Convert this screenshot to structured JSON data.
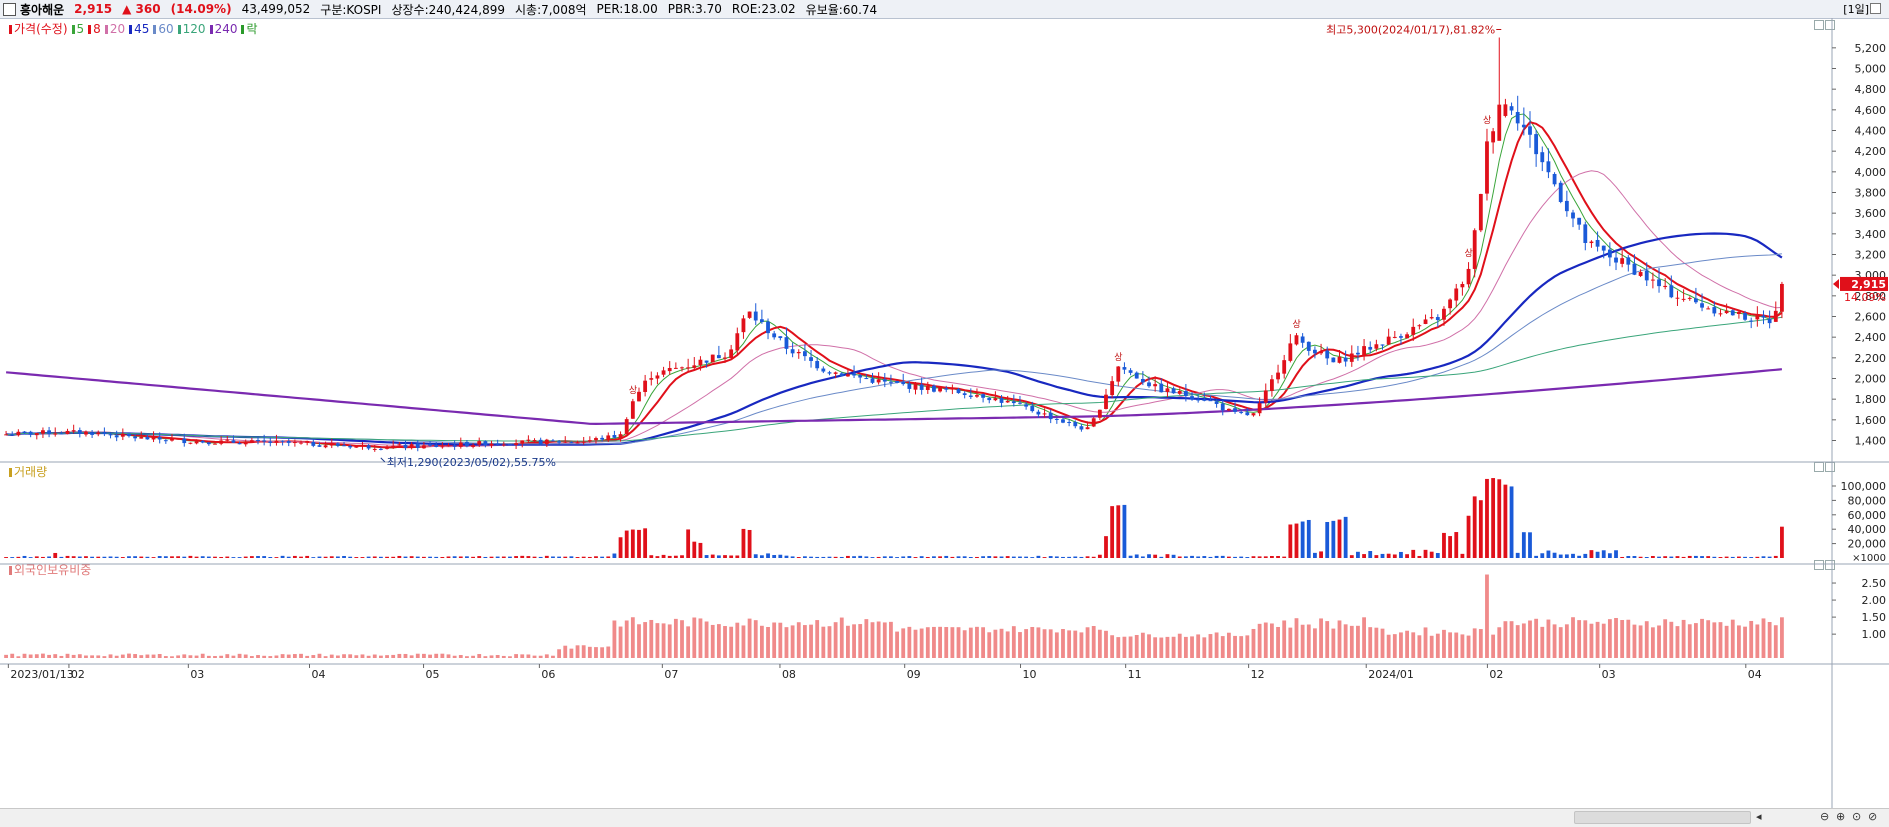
{
  "header": {
    "name": "흥아해운",
    "price": "2,915",
    "change": "▲ 360",
    "change_pct": "(14.09%)",
    "volume": "43,499,052",
    "market": "구분:KOSPI",
    "shares": "상장수:240,424,899",
    "cap": "시총:7,008억",
    "per": "PER:18.00",
    "pbr": "PBR:3.70",
    "roe": "ROE:23.02",
    "float": "유보율:60.74",
    "period": "[1일]"
  },
  "price_panel": {
    "legend": [
      {
        "label": "가격(수정)",
        "color": "#e0101a"
      },
      {
        "label": "5",
        "color": "#3aa53a"
      },
      {
        "label": "8",
        "color": "#e0101a"
      },
      {
        "label": "20",
        "color": "#d070a8"
      },
      {
        "label": "45",
        "color": "#1828c0"
      },
      {
        "label": "60",
        "color": "#6a8ac8"
      },
      {
        "label": "120",
        "color": "#3aa57a"
      },
      {
        "label": "240",
        "color": "#7a2ab0"
      },
      {
        "label": "락",
        "color": "#2a9a2a"
      }
    ],
    "high_annotation": "최고5,300(2024/01/17),81.82%",
    "low_annotation": "최저1,290(2023/05/02),55.75%",
    "price_tag": "2,915",
    "pct_tag": "14.09%"
  },
  "volume_panel": {
    "legend": "거래량"
  },
  "foreign_panel": {
    "legend": "외국인보유비중"
  },
  "limit_up_label": "상",
  "chart_data": [
    {
      "type": "candlestick",
      "title": "가격(수정)",
      "y_ticks": [
        1400,
        1600,
        1800,
        2000,
        2200,
        2400,
        2600,
        2800,
        3000,
        3200,
        3400,
        3600,
        3800,
        4000,
        4200,
        4400,
        4600,
        4800,
        5000,
        5200
      ],
      "ylim": [
        1250,
        5450
      ],
      "x_labels": [
        "2023/01/13",
        "02",
        "03",
        "04",
        "05",
        "06",
        "07",
        "08",
        "09",
        "10",
        "11",
        "12",
        "2024/01",
        "02",
        "03",
        "04"
      ],
      "key_points": [
        {
          "date": "2023/01/13",
          "close": 1460
        },
        {
          "date": "2023/05/02",
          "low": 1290
        },
        {
          "date": "2023/06 (spike)",
          "close": 2000
        },
        {
          "date": "2023/07",
          "high": 3080
        },
        {
          "date": "2023/10 (spike)",
          "high": 2520
        },
        {
          "date": "2023/11 (spike)",
          "high": 2500
        },
        {
          "date": "2024/01/17",
          "high": 5300
        },
        {
          "date": "last",
          "close": 2915
        }
      ],
      "series": [
        {
          "name": "5",
          "color": "#3aa53a"
        },
        {
          "name": "8",
          "color": "#e0101a"
        },
        {
          "name": "20",
          "color": "#d070a8"
        },
        {
          "name": "45",
          "color": "#1828c0"
        },
        {
          "name": "60",
          "color": "#6a8ac8"
        },
        {
          "name": "120",
          "color": "#3aa57a"
        },
        {
          "name": "240",
          "color": "#7a2ab0"
        }
      ]
    },
    {
      "type": "bar",
      "title": "거래량",
      "y_ticks": [
        20000,
        40000,
        60000,
        80000,
        100000
      ],
      "ylim": [
        0,
        125000
      ],
      "unit": "×1000",
      "spikes": [
        {
          "date": "2023/01",
          "value": 7000
        },
        {
          "date": "2023/06",
          "value": 36000
        },
        {
          "date": "2023/07",
          "value": 38000
        },
        {
          "date": "2023/10",
          "value": 72000
        },
        {
          "date": "2023/11",
          "value": 50000
        },
        {
          "date": "2023/12",
          "value": 38000
        },
        {
          "date": "2024/01",
          "value": 108000
        },
        {
          "date": "last",
          "value": 43499
        }
      ]
    },
    {
      "type": "bar",
      "title": "외국인보유비중",
      "y_ticks": [
        1.0,
        1.5,
        2.0,
        2.5
      ],
      "ylim": [
        0.3,
        3.0
      ],
      "spikes": [
        {
          "date": "2024/01",
          "value": 2.75
        }
      ]
    }
  ]
}
